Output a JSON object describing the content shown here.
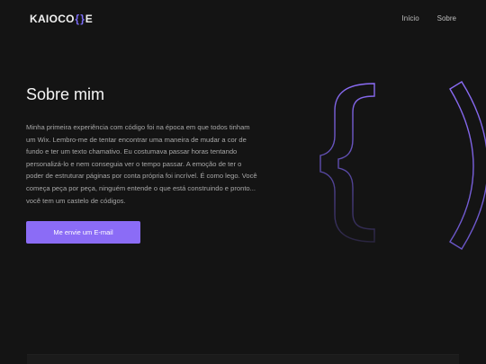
{
  "header": {
    "logo_prefix": "KAIOCO",
    "logo_brace_open": "{",
    "logo_brace_close": "}",
    "logo_suffix": "E",
    "nav": [
      {
        "label": "Início"
      },
      {
        "label": "Sobre"
      }
    ]
  },
  "hero": {
    "title": "Sobre mim",
    "text": "Minha primeira experiência com código foi na época em que todos tinham um Wix. Lembro-me de tentar encontrar uma maneira de mudar a cor de fundo e ter um texto chamativo. Eu costumava passar horas tentando personalizá-lo e nem conseguia ver o tempo passar. A emoção de ter o poder de estruturar páginas por conta própria foi incrível. É como lego. Você começa peça por peça, ninguém entende o que está construindo e pronto... você tem um castelo de códigos.",
    "cta_label": "Me envie um E-mail"
  },
  "colors": {
    "background": "#141414",
    "accent": "#8b6cf6",
    "text": "#a7a7a7",
    "heading": "#f5f5f5"
  },
  "icons": {
    "decoration": "curly-brace-outline-icon"
  }
}
